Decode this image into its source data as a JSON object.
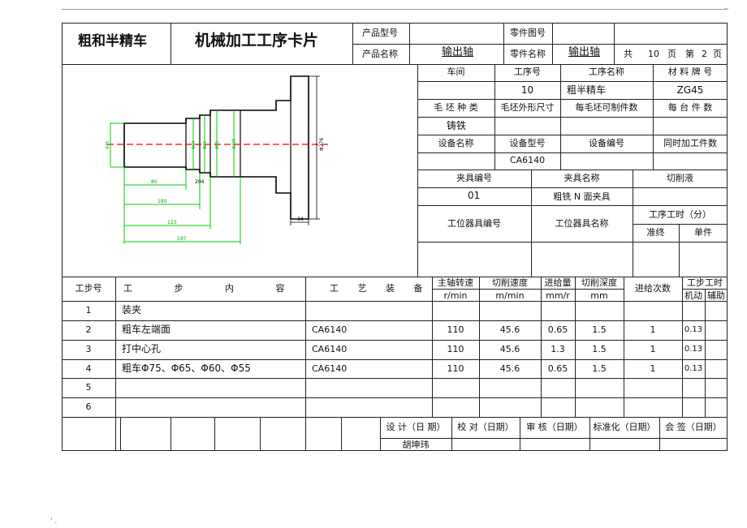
{
  "corner_mark_top": "..",
  "corner_mark_bottom": "' .",
  "header": {
    "left_title": "粗和半精车",
    "main_title": "机械加工工序卡片",
    "product_model_label": "产品型号",
    "product_model_value": "",
    "part_drawing_label": "零件图号",
    "part_drawing_value": "",
    "product_name_label": "产品名称",
    "product_name_value": "输出轴",
    "part_name_label": "零件名称",
    "part_name_value": "输出轴",
    "total_label": "共",
    "total_pages": "10",
    "page_unit": "页",
    "page_label": "第",
    "page_number": "2",
    "page_unit2": "页"
  },
  "info": {
    "workshop_label": "车间",
    "process_no_label": "工序号",
    "process_name_label": "工序名称",
    "material_label": "材 料 牌 号",
    "workshop_value": "",
    "process_no_value": "10",
    "process_name_value": "粗半精车",
    "material_value": "ZG45",
    "blank_type_label": "毛 坯 种 类",
    "blank_size_label": "毛坯外形尺寸",
    "parts_per_blank_label": "每毛坯可制件数",
    "per_unit_label": "每 台 件 数",
    "blank_type_value": "铸铁",
    "equip_name_label": "设备名称",
    "equip_model_label": "设备型号",
    "equip_no_label": "设备编号",
    "simul_label": "同时加工件数",
    "equip_model_value": "CA6140",
    "fixture_no_label": "夹具编号",
    "fixture_name_label": "夹具名称",
    "coolant_label": "切削液",
    "fixture_no_value": "01",
    "fixture_name_value": "粗铣 N 面夹具",
    "station_tool_no_label": "工位器具编号",
    "station_tool_name_label": "工位器具名称",
    "time_label": "工序工时（分）",
    "prep_label": "准终",
    "unit_label": "单件"
  },
  "drawing": {
    "dims": [
      "80",
      "180",
      "123",
      "197",
      "204",
      "34",
      "Φ276",
      "Φ75",
      "Φ60",
      "Φ65",
      "Φ55",
      "Φ225"
    ]
  },
  "steps_header": {
    "step_no": "工步号",
    "content": "工 步 内 容",
    "equipment": "工 艺 装 备",
    "spindle": "主轴转速",
    "spindle_unit": "r/min",
    "cut_speed": "切削速度",
    "cut_speed_unit": "m/min",
    "feed": "进给量",
    "feed_unit": "mm/r",
    "depth": "切削深度",
    "depth_unit": "mm",
    "passes": "进给次数",
    "step_time": "工步工时",
    "machine": "机动",
    "aux": "辅助"
  },
  "steps": [
    {
      "no": "1",
      "content": "装夹",
      "equip": "",
      "spindle": "",
      "speed": "",
      "feed": "",
      "depth": "",
      "passes": "",
      "machine": ""
    },
    {
      "no": "2",
      "content": "粗车左端面",
      "equip": "CA6140",
      "spindle": "110",
      "speed": "45.6",
      "feed": "0.65",
      "depth": "1.5",
      "passes": "1",
      "machine": "0.13"
    },
    {
      "no": "3",
      "content": "打中心孔",
      "equip": "CA6140",
      "spindle": "110",
      "speed": "45.6",
      "feed": "1.3",
      "depth": "1.5",
      "passes": "1",
      "machine": "0.13"
    },
    {
      "no": "4",
      "content": "粗车Φ75、Φ65、Φ60、Φ55",
      "equip": "CA6140",
      "spindle": "110",
      "speed": "45.6",
      "feed": "0.65",
      "depth": "1.5",
      "passes": "1",
      "machine": "0.13"
    },
    {
      "no": "5",
      "content": "",
      "equip": "",
      "spindle": "",
      "speed": "",
      "feed": "",
      "depth": "",
      "passes": "",
      "machine": ""
    },
    {
      "no": "6",
      "content": "",
      "equip": "",
      "spindle": "",
      "speed": "",
      "feed": "",
      "depth": "",
      "passes": "",
      "machine": ""
    }
  ],
  "footer": {
    "design": "设 计（日 期）",
    "check": "校 对（日期）",
    "review": "审 核（日期）",
    "standard": "标准化（日期）",
    "sign": "会 签（日期）",
    "designer": "胡坤玮"
  },
  "colors": {
    "line": "#222222",
    "dim_green": "#00cc00",
    "center_red": "#ff0000",
    "outline": "#000000"
  }
}
